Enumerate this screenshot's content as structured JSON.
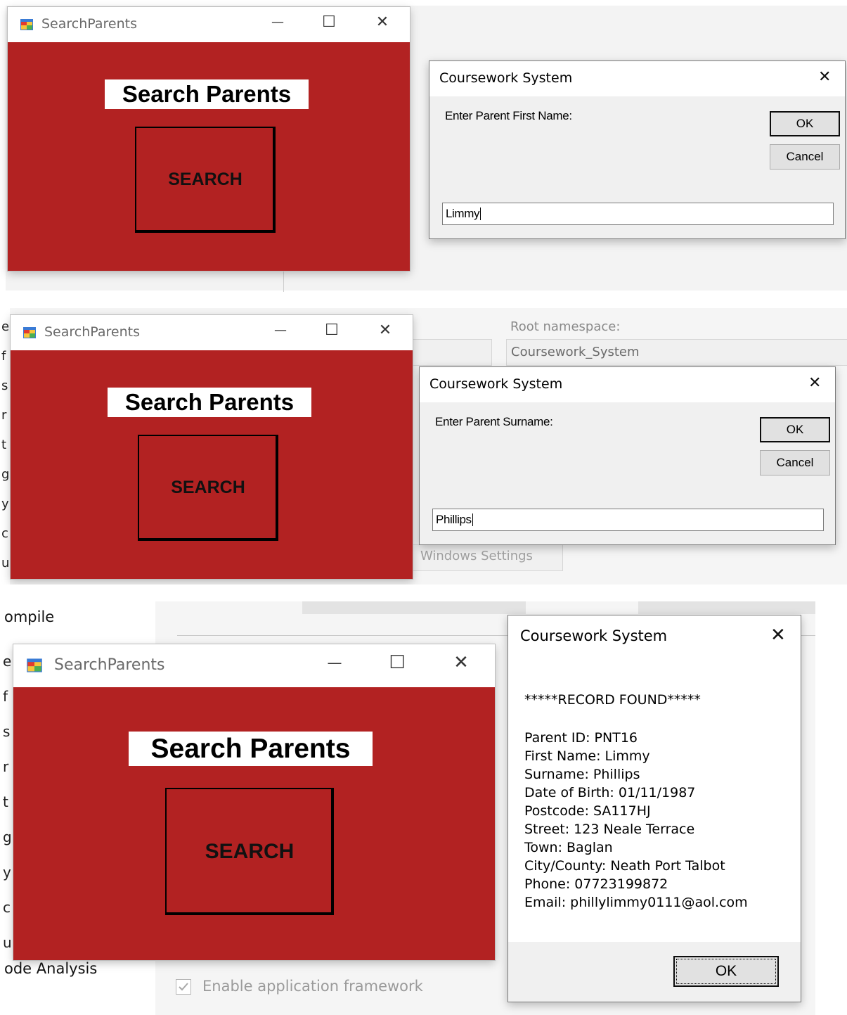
{
  "colors": {
    "form_red": "#b22222",
    "dialog_bg": "#f0f0f0",
    "title_gray": "#6a6a6a"
  },
  "icons": {
    "app": "form-app-icon",
    "minimize": "minimize-icon",
    "maximize": "maximize-icon",
    "close": "close-icon",
    "checkbox": "checkbox-icon"
  },
  "glyphs": {
    "minimize": "—",
    "maximize": "☐",
    "close": "✕"
  },
  "form": {
    "title": "SearchParents",
    "heading": "Search Parents",
    "search_label": "SEARCH"
  },
  "panel1": {
    "dialog": {
      "title": "Coursework System",
      "prompt": "Enter Parent First Name:",
      "ok": "OK",
      "cancel": "Cancel",
      "value": "Limmy"
    }
  },
  "panel2": {
    "background": {
      "root_namespace_label": "Root namespace:",
      "root_namespace_value": "Coursework_System",
      "windows_settings": "Windows Settings",
      "side_glyphs": [
        "e",
        "f",
        "s",
        "r",
        "t",
        "g",
        "y",
        "c",
        "u"
      ]
    },
    "dialog": {
      "title": "Coursework System",
      "prompt": "Enter Parent Surname:",
      "ok": "OK",
      "cancel": "Cancel",
      "value": "Phillips"
    }
  },
  "panel3": {
    "background": {
      "compile": "ompile",
      "code_analysis": "ode Analysis",
      "enable_framework": "Enable application framework",
      "side_glyphs": [
        "e",
        "f",
        "s",
        "r",
        "t",
        "g",
        "y",
        "c",
        "u"
      ]
    },
    "dialog": {
      "title": "Coursework System",
      "header": "*****RECORD FOUND*****",
      "lines": [
        "Parent ID: PNT16",
        "First Name: Limmy",
        "Surname: Phillips",
        "Date of Birth: 01/11/1987",
        "Postcode: SA117HJ",
        "Street: 123 Neale Terrace",
        "Town: Baglan",
        "City/County: Neath Port Talbot",
        "Phone: 07723199872",
        "Email: phillylimmy0111@aol.com"
      ],
      "ok": "OK"
    }
  }
}
